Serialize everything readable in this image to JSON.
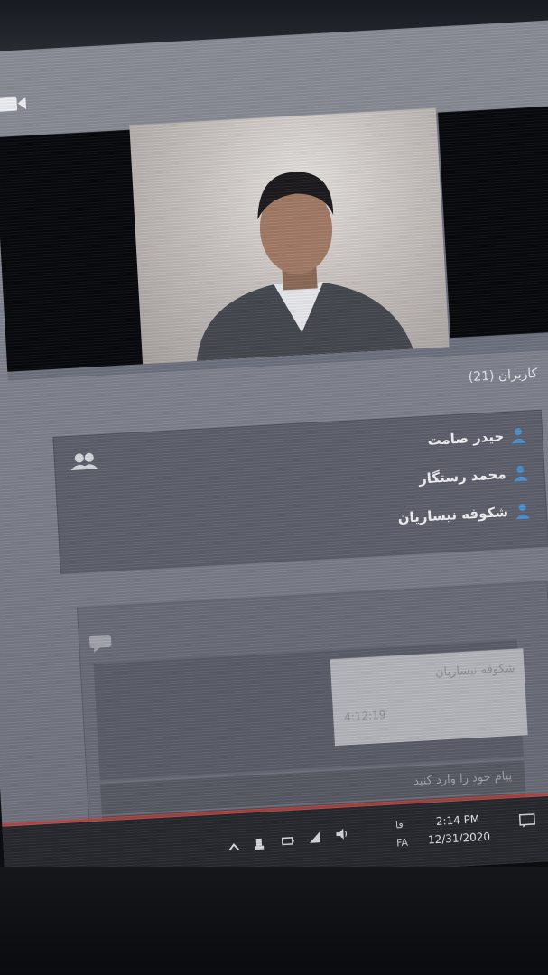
{
  "users": {
    "header": "کاربران (21)",
    "list": [
      {
        "name": "حیدر صامت"
      },
      {
        "name": "محمد رستگار"
      },
      {
        "name": "شکوفه نیساریان"
      }
    ]
  },
  "chat": {
    "message": {
      "sender": "شکوفه نیساریان",
      "time": "4:12:19"
    },
    "input_placeholder": "پیام خود را وارد کنید"
  },
  "taskbar": {
    "language_short": "فا",
    "language_code": "FA",
    "time": "2:14 PM",
    "date": "12/31/2020"
  },
  "icons": {
    "camera": "video-camera-icon",
    "users_group": "users-group-icon",
    "user": "user-icon",
    "chat": "chat-bubble-icon",
    "send": "send-arrow-icon",
    "emoji": "smiley-icon",
    "notifications": "notification-icon"
  },
  "colors": {
    "user_icon": "#4a8fd0",
    "taskbar_accent": "#c0403a",
    "panel_bg": "#5e616c"
  }
}
